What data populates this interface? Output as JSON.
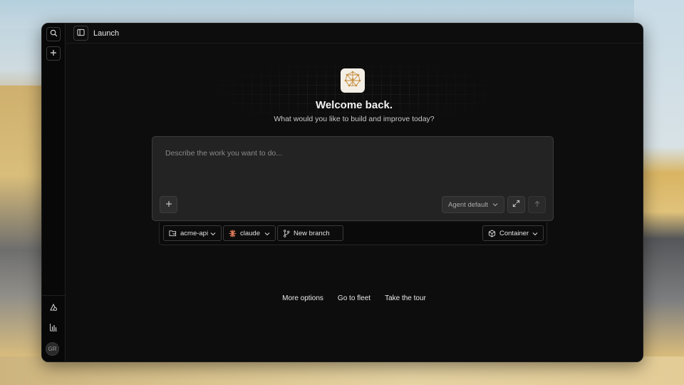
{
  "window": {
    "title": "Launch"
  },
  "main": {
    "heading": "Welcome back.",
    "subtitle": "What would you like to build and improve today?"
  },
  "composer": {
    "placeholder": "Describe the work you want to do...",
    "agent_select": "Agent default"
  },
  "options": {
    "repo": "acme-api",
    "model": "claude",
    "branch": "New branch",
    "environment": "Container"
  },
  "links": {
    "more_options": "More options",
    "go_to_fleet": "Go to fleet",
    "take_tour": "Take the tour"
  },
  "user": {
    "initials": "GR"
  },
  "colors": {
    "window_bg": "#0d0d0d",
    "composer_bg": "#232323",
    "logo_accent": "#c48a3a"
  }
}
